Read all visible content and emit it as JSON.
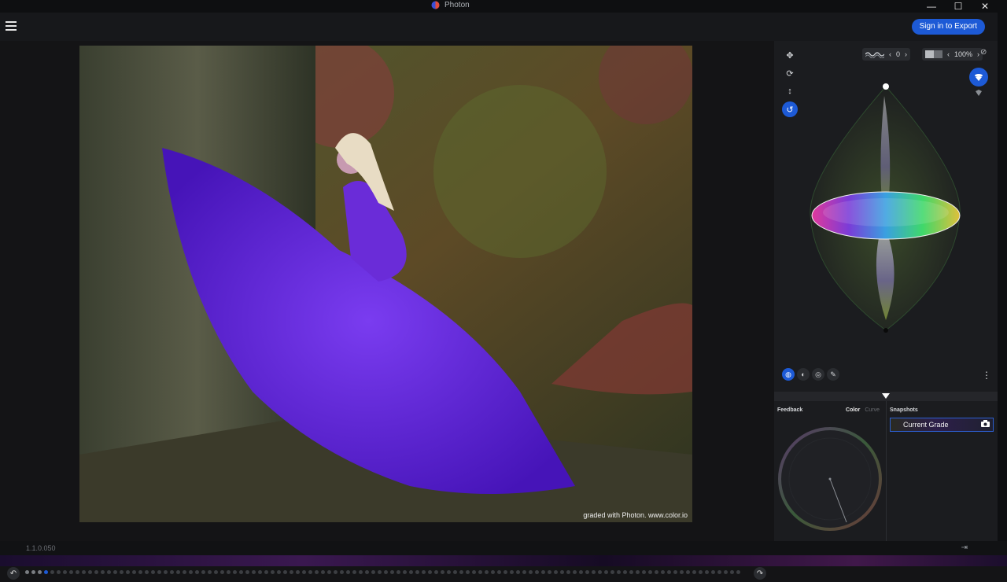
{
  "window": {
    "title": "Photon",
    "minimize": "—",
    "maximize": "☐",
    "close": "✕"
  },
  "header": {
    "sign_in_label": "Sign in to Export"
  },
  "viewer": {
    "watermark": "graded with Photon. www.color.io"
  },
  "timeline": {
    "undo_icon": "↶",
    "redo_icon": "↷",
    "active_index": 4
  },
  "status": {
    "version": "1.1.0.050",
    "pin_icon": "⇥"
  },
  "tools": {
    "move_icon": "✥",
    "hue_icon": "⟳",
    "vertical_icon": "↕",
    "rotate_icon": "↺"
  },
  "controls": {
    "noise_value": "0",
    "noise_prev": "‹",
    "noise_next": "›",
    "opacity_value": "100%",
    "opacity_prev": "‹",
    "opacity_next": "›",
    "eye_off_icon": "⊘"
  },
  "mode_bar": {
    "buttons": [
      "◍",
      "◐",
      "◎",
      "✎"
    ],
    "active": 0,
    "kebab_icon": "⋮"
  },
  "feedback": {
    "title": "Feedback",
    "tab_color": "Color",
    "tab_curve": "Curve"
  },
  "snapshots": {
    "title": "Snapshots",
    "current": "Current Grade",
    "camera_icon": "📷"
  },
  "colors": {
    "accent": "#1d5ad6",
    "panel": "#1b1c1f",
    "background": "#141416"
  }
}
